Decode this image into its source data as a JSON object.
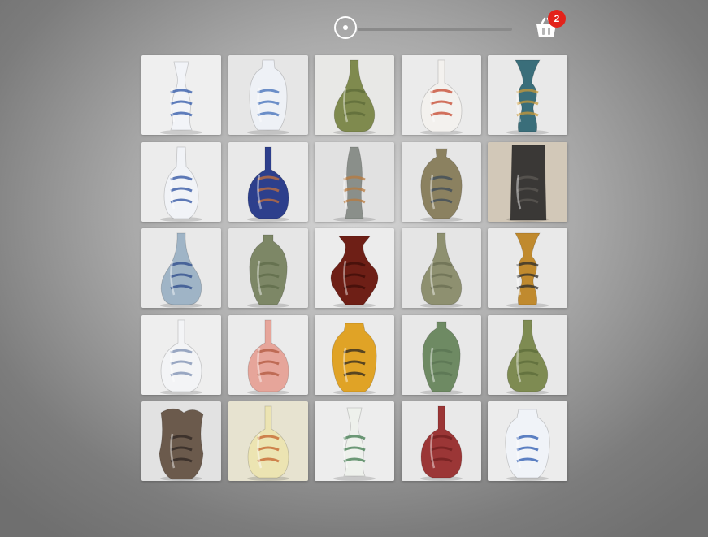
{
  "header": {
    "cart_count": "2",
    "slider": {
      "value": 0
    }
  },
  "icons": {
    "cart": "basket-icon",
    "slider_handle": "slider-handle"
  },
  "gallery": {
    "items": [
      {
        "name": "vase-blue-white-dragon-beaker",
        "bg": "#efefef",
        "body": "#f2f4f8",
        "accent": "#2c55a8",
        "shape": "beaker"
      },
      {
        "name": "vase-blue-white-landscape-baluster",
        "bg": "#e6e6e6",
        "body": "#eef1f6",
        "accent": "#3f6cb8",
        "shape": "baluster"
      },
      {
        "name": "vase-green-celadon-pear",
        "bg": "#e8e8e6",
        "body": "#7f8a4e",
        "accent": "#5c6a38",
        "shape": "pear"
      },
      {
        "name": "vase-famille-red-floral-bottle",
        "bg": "#ebebeb",
        "body": "#f3f1ee",
        "accent": "#c6442b",
        "shape": "bottle"
      },
      {
        "name": "vase-cloisonne-blue-gu",
        "bg": "#e9e9e9",
        "body": "#3a6e7a",
        "accent": "#c89a3a",
        "shape": "gu"
      },
      {
        "name": "vase-blue-white-ring-handled",
        "bg": "#ececec",
        "body": "#f1f3f7",
        "accent": "#2a4fa0",
        "shape": "handled"
      },
      {
        "name": "vase-blue-gilt-bottle",
        "bg": "#e9e9e9",
        "body": "#2d3f8c",
        "accent": "#c8723a",
        "shape": "bottle"
      },
      {
        "name": "vase-twisted-stoneware",
        "bg": "#e1e1e1",
        "body": "#8a8f8a",
        "accent": "#b87a3c",
        "shape": "twist"
      },
      {
        "name": "vase-drip-glaze-ovoid",
        "bg": "#e6e6e6",
        "body": "#8b8160",
        "accent": "#3b4a58",
        "shape": "ovoid"
      },
      {
        "name": "vase-dark-carved-cylinder",
        "bg": "#d2c8b8",
        "body": "#3a3836",
        "accent": "#5d5a55",
        "shape": "cylinder"
      },
      {
        "name": "vase-blue-floral-pear",
        "bg": "#e9e9e9",
        "body": "#9fb4c6",
        "accent": "#2b4a8a",
        "shape": "pear"
      },
      {
        "name": "vase-celadon-meiping",
        "bg": "#e6e6e6",
        "body": "#7d8766",
        "accent": "#5f6b4a",
        "shape": "meiping"
      },
      {
        "name": "vase-brown-lacquer-ribbed",
        "bg": "#ececec",
        "body": "#6e1f16",
        "accent": "#3e0d08",
        "shape": "ribbed"
      },
      {
        "name": "vase-green-crackle-pear",
        "bg": "#e5e5e5",
        "body": "#8e9070",
        "accent": "#6a6d52",
        "shape": "pear"
      },
      {
        "name": "vase-gold-black-baluster",
        "bg": "#e9e9e9",
        "body": "#c08a2e",
        "accent": "#2b2b2b",
        "shape": "gu"
      },
      {
        "name": "vase-white-blue-bird-bottle",
        "bg": "#eeeeee",
        "body": "#f3f4f6",
        "accent": "#7b8db0",
        "shape": "bottle"
      },
      {
        "name": "vase-pink-carved-bottle",
        "bg": "#ebebeb",
        "body": "#e6a59a",
        "accent": "#b0583e",
        "shape": "bottle"
      },
      {
        "name": "vase-yellow-black-marbled",
        "bg": "#ebebeb",
        "body": "#e0a326",
        "accent": "#2b2620",
        "shape": "jar"
      },
      {
        "name": "vase-celadon-tall-baluster",
        "bg": "#e8e8e8",
        "body": "#6e8a63",
        "accent": "#5a7352",
        "shape": "meiping"
      },
      {
        "name": "vase-green-carved-dish-top",
        "bg": "#e8e8e8",
        "body": "#7e8b52",
        "accent": "#5c6b3a",
        "shape": "pear"
      },
      {
        "name": "vase-bronze-folded-metal",
        "bg": "#e2e2e2",
        "body": "#6b5a4c",
        "accent": "#2e2621",
        "shape": "folded"
      },
      {
        "name": "vase-satsuma-floral-bottle",
        "bg": "#e7e3d0",
        "body": "#ece4b2",
        "accent": "#c4612a",
        "shape": "bottle"
      },
      {
        "name": "vase-famille-verte-figures",
        "bg": "#ededed",
        "body": "#eef1ec",
        "accent": "#3f7a4e",
        "shape": "beaker"
      },
      {
        "name": "vase-copper-red-bottle",
        "bg": "#e9e9e9",
        "body": "#9b3636",
        "accent": "#6f1f1f",
        "shape": "bottle"
      },
      {
        "name": "vase-blue-white-covered-jar",
        "bg": "#ececec",
        "body": "#f0f3f8",
        "accent": "#2a58b0",
        "shape": "jar"
      }
    ]
  }
}
